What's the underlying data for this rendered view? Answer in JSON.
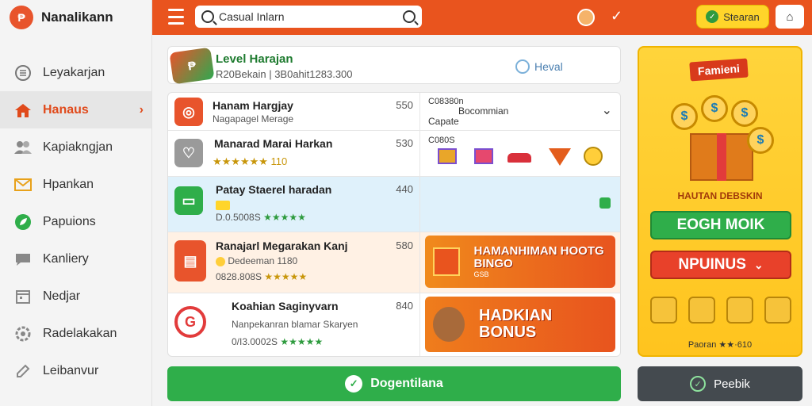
{
  "brand": {
    "name": "Nanalikann"
  },
  "sidebar": {
    "items": [
      {
        "label": "Leyakarjan",
        "icon": "list-icon"
      },
      {
        "label": "Hanaus",
        "icon": "home-icon",
        "active": true
      },
      {
        "label": "Kapiakngjan",
        "icon": "users-icon"
      },
      {
        "label": "Hpankan",
        "icon": "mail-icon"
      },
      {
        "label": "Papuions",
        "icon": "leaf-icon"
      },
      {
        "label": "Kanliery",
        "icon": "chat-icon"
      },
      {
        "label": "Nedjar",
        "icon": "calendar-icon"
      },
      {
        "label": "Radelakakan",
        "icon": "settings-icon"
      },
      {
        "label": "Leibanvur",
        "icon": "edit-icon"
      }
    ]
  },
  "topbar": {
    "search_value": "Casual Inlarn",
    "status_label": "Stearan",
    "accent": "#e9541e"
  },
  "header": {
    "title": "Level Harajan",
    "subtitle": "R20Bekain | 3B0ahit1283.300",
    "level_label": "Heval"
  },
  "rows": [
    {
      "title": "Hanam Hargjay",
      "sub": "Nagapagel Merage",
      "num": "550",
      "right_title": "C08380n",
      "right_sub": "Bocommian",
      "right_sub2": "Capate"
    },
    {
      "title": "Manarad Marai Harkan",
      "stars": "★★★★★★ 110",
      "num": "530",
      "right_label": "C080S"
    },
    {
      "title": "Patay Staerel haradan",
      "sub": "D.0.5008S",
      "stars": "★★★★★",
      "num": "440"
    },
    {
      "title": "Ranajarl Megarakan Kanj",
      "sub": "Dedeeman 1180",
      "sub2": "0828.808S",
      "stars": "★★★★★",
      "num": "580",
      "banner": "HAMANHIMAN HOOTG BINGO",
      "banner_sub": "GSB"
    },
    {
      "title": "Koahian Saginyvarn",
      "sub": "Nanpekanran blamar Skaryen",
      "sub2": "0/I3.0002S",
      "stars": "★★★★★",
      "num": "840",
      "banner": "HADKIAN BONUS"
    }
  ],
  "main_button": "Dogentilana",
  "promo": {
    "title": "Famieni",
    "subtitle": "HAUTAN DEBSKIN",
    "button1": "EOGH MOIK",
    "button2": "NPUINUS",
    "rating_prefix": "Paoran",
    "rating_stars": "★★",
    "rating_suffix": "·610"
  },
  "side_button": "Peebik"
}
